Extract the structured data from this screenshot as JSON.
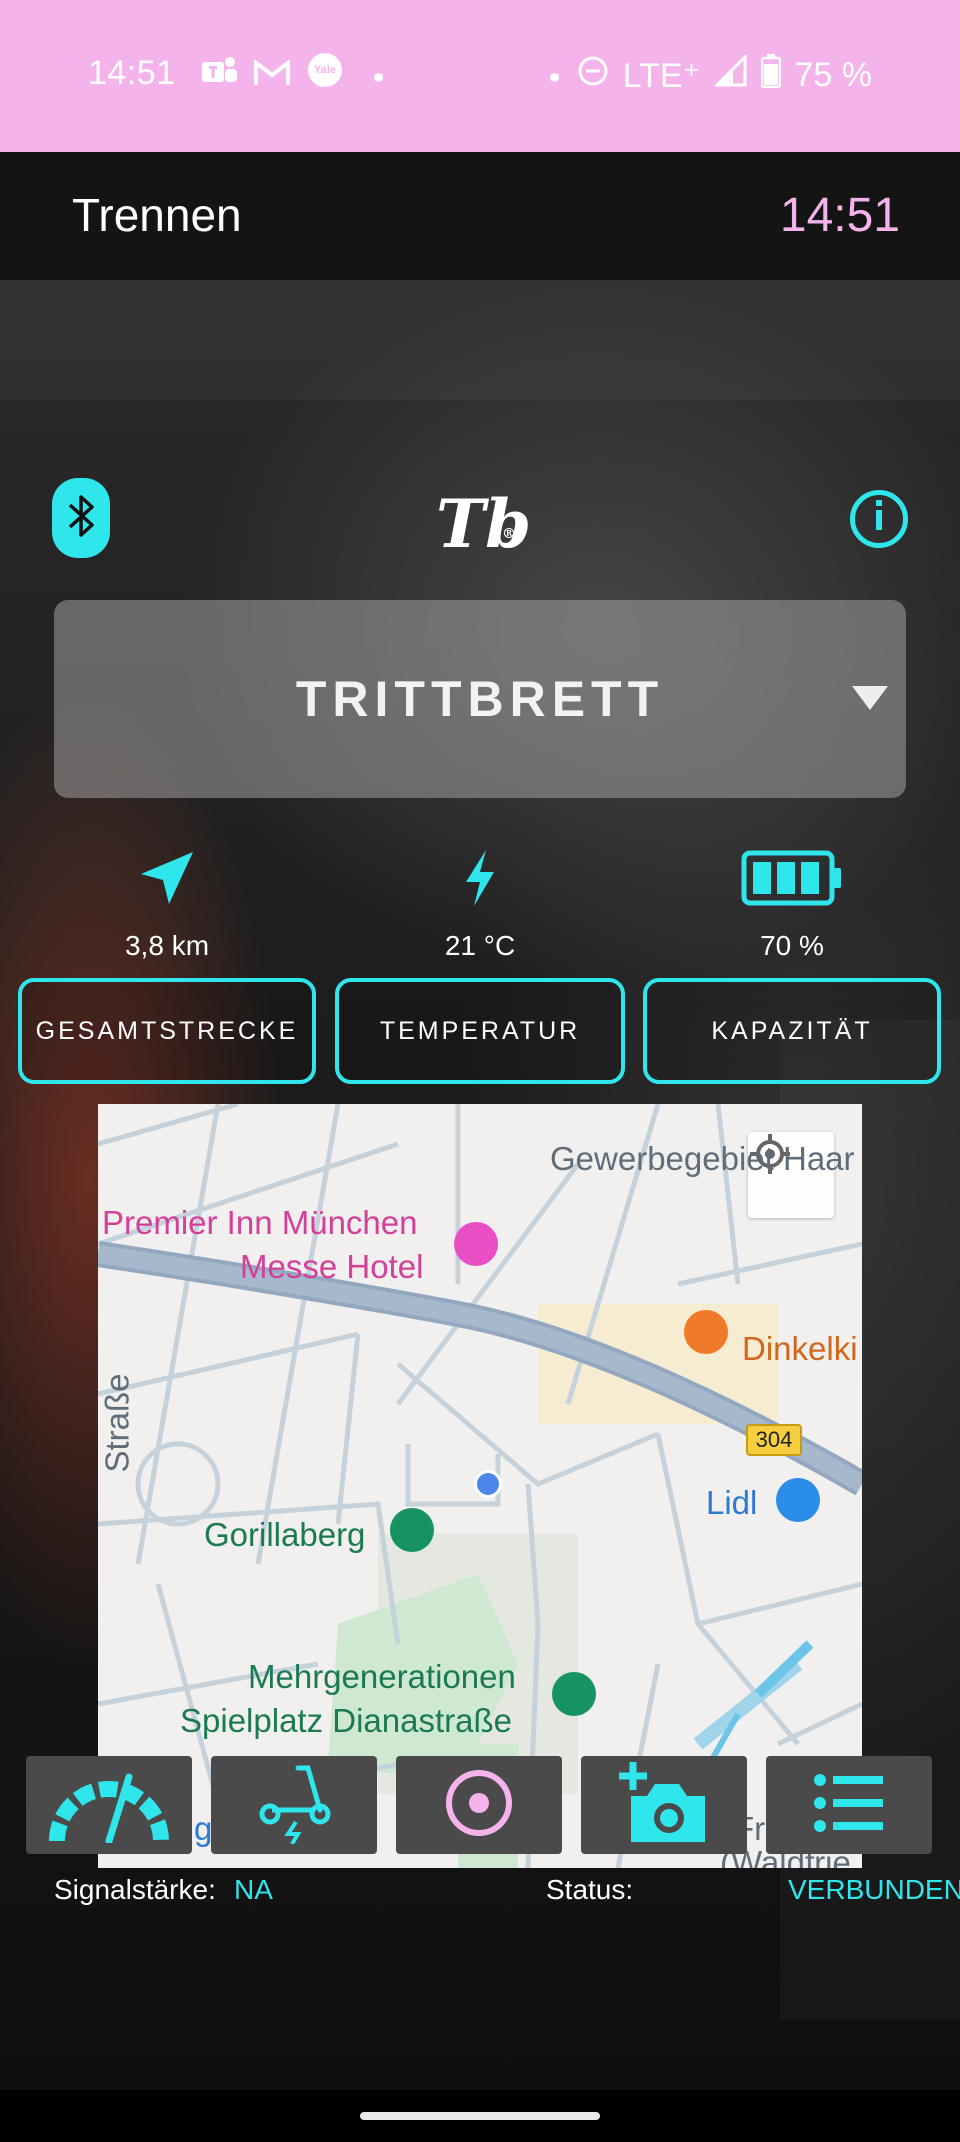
{
  "status_bar": {
    "time": "14:51",
    "network": "LTE⁺",
    "battery": "75 %",
    "icons": [
      "teams-icon",
      "gmail-icon",
      "yale-icon",
      "dnd-icon",
      "signal-icon",
      "battery-icon"
    ],
    "yale_text": "Yale"
  },
  "app_bar": {
    "title": "Trennen",
    "clock": "14:51"
  },
  "header": {
    "logo": "Tb",
    "logo_mark": "®"
  },
  "device_selector": {
    "name": "TRITTBRETT"
  },
  "stats": [
    {
      "icon": "navigation-arrow-icon",
      "value": "3,8 km",
      "label": "GESAMTSTRECKE"
    },
    {
      "icon": "lightning-icon",
      "value": "21 °C",
      "label": "TEMPERATUR"
    },
    {
      "icon": "battery-icon",
      "value": "70 %",
      "label": "KAPAZITÄT"
    }
  ],
  "map": {
    "labels": {
      "gewerbe": "Gewerbegebiet Haar",
      "hotel_1": "Premier Inn München",
      "hotel_2": "Messe Hotel",
      "strasse": "Straße",
      "dinkel": "Dinkelki",
      "lidl": "Lidl",
      "gorillaberg": "Gorillaberg",
      "spielplatz_1": "Mehrgenerationen",
      "spielplatz_2": "Spielplatz Dianastraße",
      "fr": "Fr",
      "waldfried": "(Waldfrie",
      "g": "g"
    },
    "road_number": "304"
  },
  "bottom_nav": [
    {
      "icon": "speedometer-icon"
    },
    {
      "icon": "scooter-icon"
    },
    {
      "icon": "record-icon"
    },
    {
      "icon": "add-photo-icon"
    },
    {
      "icon": "list-icon"
    }
  ],
  "status_line": {
    "signal_label": "Signalstärke:",
    "signal_value": "NA",
    "status_label": "Status:",
    "status_value": "VERBUNDEN"
  },
  "colors": {
    "accent": "#2ee6ec",
    "status_bar": "#f5b3ec",
    "clock": "#f5b3ec"
  }
}
